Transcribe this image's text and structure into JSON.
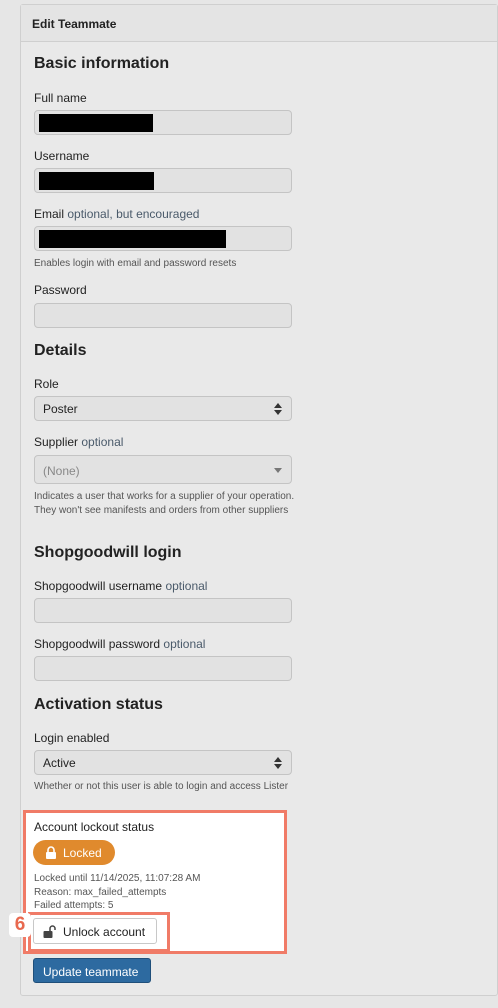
{
  "panel": {
    "title": "Edit Teammate"
  },
  "basic": {
    "title": "Basic information",
    "full_name_label": "Full name",
    "username_label": "Username",
    "email_label": "Email",
    "email_optional": "optional, but encouraged",
    "email_help": "Enables login with email and password resets",
    "password_label": "Password"
  },
  "details": {
    "title": "Details",
    "role_label": "Role",
    "role_value": "Poster",
    "supplier_label": "Supplier",
    "supplier_optional": "optional",
    "supplier_value": "(None)",
    "supplier_help": "Indicates a user that works for a supplier of your operation. They won't see manifests and orders from other suppliers"
  },
  "shopgoodwill": {
    "title": "Shopgoodwill login",
    "username_label": "Shopgoodwill username",
    "username_optional": "optional",
    "password_label": "Shopgoodwill password",
    "password_optional": "optional"
  },
  "activation": {
    "title": "Activation status",
    "login_label": "Login enabled",
    "login_value": "Active",
    "login_help": "Whether or not this user is able to login and access Lister"
  },
  "lockout": {
    "title": "Account lockout status",
    "badge": "Locked",
    "locked_until": "Locked until 11/14/2025, 11:07:28 AM",
    "reason": "Reason: max_failed_attempts",
    "failed_attempts": "Failed attempts: 5",
    "unlock_label": "Unlock account",
    "step_number": "6"
  },
  "actions": {
    "update_label": "Update teammate"
  },
  "colors": {
    "highlight": "#f07b67",
    "locked_badge": "#e08a2d",
    "primary_button": "#2d6aa0"
  },
  "icons": {
    "select_caret": "chevron-up-down-icon",
    "dropdown_caret": "chevron-down-icon",
    "lock": "lock-icon",
    "unlock": "unlock-icon"
  }
}
